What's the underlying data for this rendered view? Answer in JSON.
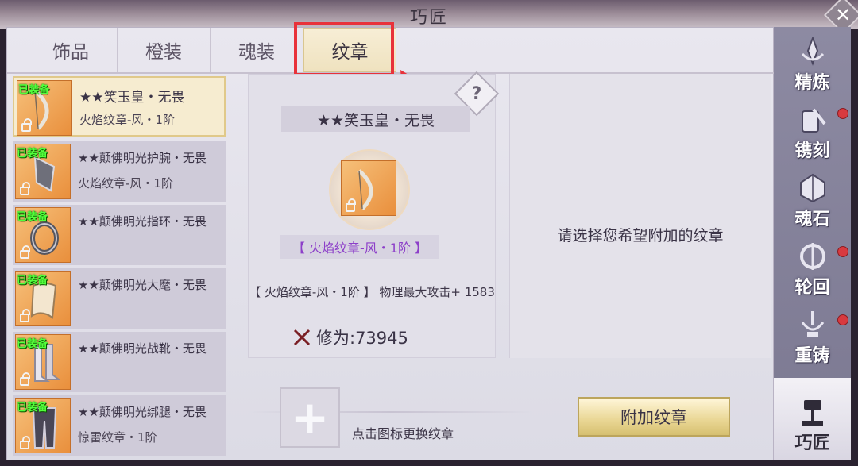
{
  "window": {
    "title": "巧匠"
  },
  "tabs": [
    {
      "label": "饰品"
    },
    {
      "label": "橙装"
    },
    {
      "label": "魂装"
    },
    {
      "label": "纹章",
      "active": true
    }
  ],
  "items": [
    {
      "badge": "已装备",
      "name": "★★笑玉皇・无畏",
      "sub": "火焰纹章-风・1阶",
      "selected": true
    },
    {
      "badge": "已装备",
      "name": "★★颠佛明光护腕・无畏",
      "sub": "火焰纹章-风・1阶"
    },
    {
      "badge": "已装备",
      "name": "★★颠佛明光指环・无畏",
      "sub": ""
    },
    {
      "badge": "已装备",
      "name": "★★颠佛明光大麾・无畏",
      "sub": ""
    },
    {
      "badge": "已装备",
      "name": "★★颠佛明光战靴・无畏",
      "sub": ""
    },
    {
      "badge": "已装备",
      "name": "★★颠佛明光绑腿・无畏",
      "sub": "惊雷纹章・1阶"
    }
  ],
  "detail": {
    "help": "?",
    "name": "★★笑玉皇・无畏",
    "rune": "【 火焰纹章-风・1阶 】",
    "stat": "【 火焰纹章-风・1阶 】 物理最大攻击+ 1583",
    "cultivation": "修为:73945"
  },
  "info": {
    "hint": "请选择您希望附加的纹章"
  },
  "bottom": {
    "add_symbol": "+",
    "change_hint": "点击图标更换纹章",
    "attach_button": "附加纹章"
  },
  "nav": [
    {
      "label": "精炼",
      "icon": "refine-icon",
      "dot": false
    },
    {
      "label": "镌刻",
      "icon": "engrave-icon",
      "dot": true
    },
    {
      "label": "魂石",
      "icon": "soulstone-icon",
      "dot": false
    },
    {
      "label": "轮回",
      "icon": "reincarnation-icon",
      "dot": true
    },
    {
      "label": "重铸",
      "icon": "reforge-icon",
      "dot": true
    },
    {
      "label": "巧匠",
      "icon": "craftsman-icon",
      "dot": false,
      "active": true
    }
  ],
  "colors": {
    "accent_gold": "#e9d693",
    "highlight_red": "#e8323a",
    "equipped_green": "#52ff3c",
    "rune_purple": "#8d3fc9",
    "notification_red": "#d83a3f"
  }
}
